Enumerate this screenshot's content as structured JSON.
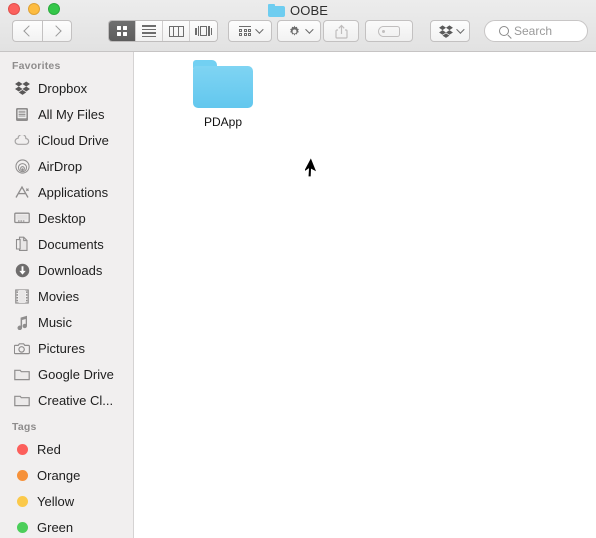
{
  "window": {
    "title": "OOBE",
    "title_icon": "folder-icon"
  },
  "traffic_lights": [
    {
      "name": "close-button",
      "color": "#fc615d"
    },
    {
      "name": "minimize-button",
      "color": "#fdbc40"
    },
    {
      "name": "maximize-button",
      "color": "#34c749"
    }
  ],
  "toolbar": {
    "back_label": "Back",
    "forward_label": "Forward",
    "view_modes": [
      {
        "name": "icon-view",
        "label": "Icon View",
        "active": true
      },
      {
        "name": "list-view",
        "label": "List View",
        "active": false
      },
      {
        "name": "column-view",
        "label": "Column View",
        "active": false
      },
      {
        "name": "coverflow-view",
        "label": "Cover Flow View",
        "active": false
      }
    ],
    "arrange_label": "Arrange",
    "action_label": "Action",
    "share_label": "Share",
    "tag_label": "Edit Tags",
    "dropbox_label": "Dropbox"
  },
  "search": {
    "placeholder": "Search",
    "value": ""
  },
  "sidebar": {
    "sections": [
      {
        "header": "Favorites",
        "items": [
          {
            "label": "Dropbox",
            "icon": "dropbox-icon"
          },
          {
            "label": "All My Files",
            "icon": "all-my-files-icon"
          },
          {
            "label": "iCloud Drive",
            "icon": "icloud-icon"
          },
          {
            "label": "AirDrop",
            "icon": "airdrop-icon"
          },
          {
            "label": "Applications",
            "icon": "applications-icon"
          },
          {
            "label": "Desktop",
            "icon": "desktop-icon"
          },
          {
            "label": "Documents",
            "icon": "documents-icon"
          },
          {
            "label": "Downloads",
            "icon": "downloads-icon"
          },
          {
            "label": "Movies",
            "icon": "movies-icon"
          },
          {
            "label": "Music",
            "icon": "music-icon"
          },
          {
            "label": "Pictures",
            "icon": "pictures-icon"
          },
          {
            "label": "Google Drive",
            "icon": "folder-icon"
          },
          {
            "label": "Creative Cl...",
            "icon": "folder-icon"
          }
        ]
      },
      {
        "header": "Tags",
        "items": [
          {
            "label": "Red",
            "icon": "tag-dot-icon",
            "color": "#fc5f5b"
          },
          {
            "label": "Orange",
            "icon": "tag-dot-icon",
            "color": "#f6913a"
          },
          {
            "label": "Yellow",
            "icon": "tag-dot-icon",
            "color": "#fbc94a"
          },
          {
            "label": "Green",
            "icon": "tag-dot-icon",
            "color": "#4cce5a"
          }
        ]
      }
    ]
  },
  "content": {
    "files": [
      {
        "name": "PDApp",
        "type": "folder",
        "color": "#6ecdf0"
      }
    ]
  },
  "colors": {
    "folder_blue": "#6ecdf0",
    "sidebar_bg": "#f1efef",
    "toolbar_bg": "#e8e8e8",
    "content_bg": "#ffffff"
  }
}
